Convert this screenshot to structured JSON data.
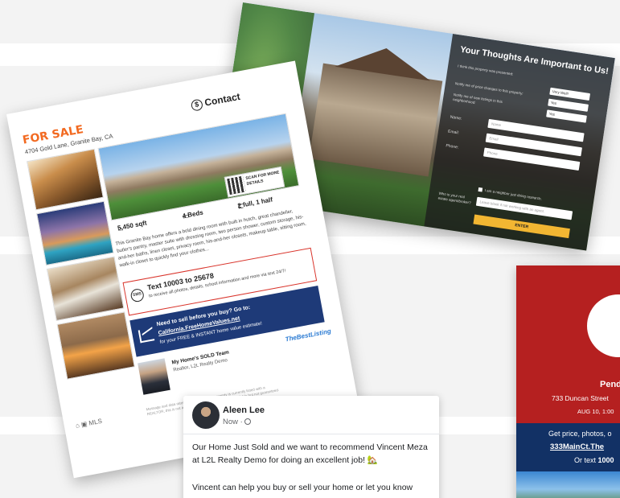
{
  "flyer": {
    "status": "FOR SALE",
    "address": "4704 Gold Lane, Granite Bay, CA",
    "contact_label": "Contact",
    "qr_text": "SCAN FOR MORE DETAILS",
    "sqft": "5,450 sqft",
    "beds": "4 Beds",
    "baths": "2 full, 1 half",
    "description": "This Granite Bay home offers a bold dining room with built in hutch, great chandelier, butler's pantry, master suite with dressing room, two person shower, custom storage, his-and-her baths, linen closet, privacy room, his-and-her closets, makeup table, sitting room, walk-in closet to quickly find your clothes...",
    "sms_title": "Text 10003 to 25678",
    "sms_sub": "to receive all photos, details, school information and more via text 24/7!",
    "cta_line1": "Need to sell before you buy? Go to:",
    "cta_link": "California.FreeHomeValues.net",
    "cta_line3": "for your FREE & INSTANT home value estimate!",
    "agent_line1": "My Home's SOLD Team",
    "agent_line2": "Realtor, L2L Realty Demo",
    "logo": "TheBestListing",
    "footer_text": "Message and data rates may apply. If your property is currently listed with a REALTOR, this is not a solicitation. Information deemed reliable but not guaranteed."
  },
  "landing": {
    "title": "Your Thoughts Are Important to Us!",
    "q1": "I think this property was presented:",
    "q1_value": "Very Well!",
    "q2": "Notify me of price changes to this property:",
    "q2_value": "Yes",
    "q3": "Notify me of new listings in this neighborhood:",
    "q3_value": "Yes",
    "name_label": "Name:",
    "name_placeholder": "Name",
    "email_label": "Email:",
    "email_placeholder": "Email",
    "phone_label": "Phone:",
    "phone_placeholder": "Phone",
    "checkbox_label": "I am a neighbor just doing research.",
    "agent_label": "Who is your real estate agent/broker?",
    "agent_placeholder": "Leave blank if not working with an agent.",
    "enter_button": "ENTER"
  },
  "post": {
    "author": "Aleen Lee",
    "time": "Now ·",
    "text1": "Our Home Just Sold and we want to recommend Vincent Meza at L2L Realty Demo for doing an excellent job! 🏡",
    "text2": "Vincent can help you buy or sell your home or let you know"
  },
  "red_card": {
    "status": "Pend",
    "address": "733 Duncan Street",
    "date": "AUG 10, 1:00",
    "line1": "Get price, photos, o",
    "link": "333MainCt.The",
    "line3_prefix": "Or text ",
    "line3_code": "1000"
  }
}
